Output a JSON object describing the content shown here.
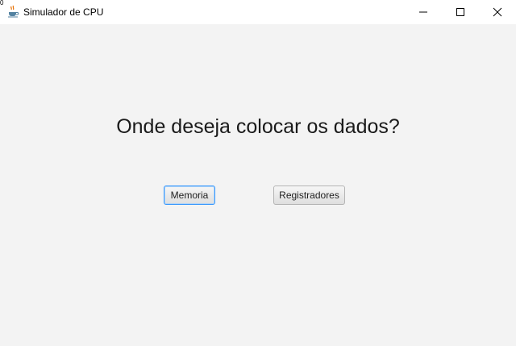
{
  "window": {
    "title": "Simulador de CPU",
    "corner_mark": "0",
    "icons": {
      "app": "java-coffee-cup-icon",
      "minimize": "minimize-icon",
      "maximize": "maximize-icon",
      "close": "close-icon"
    }
  },
  "main": {
    "question": "Onde deseja colocar os dados?",
    "buttons": {
      "memoria": "Memoria",
      "registradores": "Registradores"
    }
  },
  "colors": {
    "background": "#f3f3f3",
    "focus_border": "#3b99fc"
  }
}
